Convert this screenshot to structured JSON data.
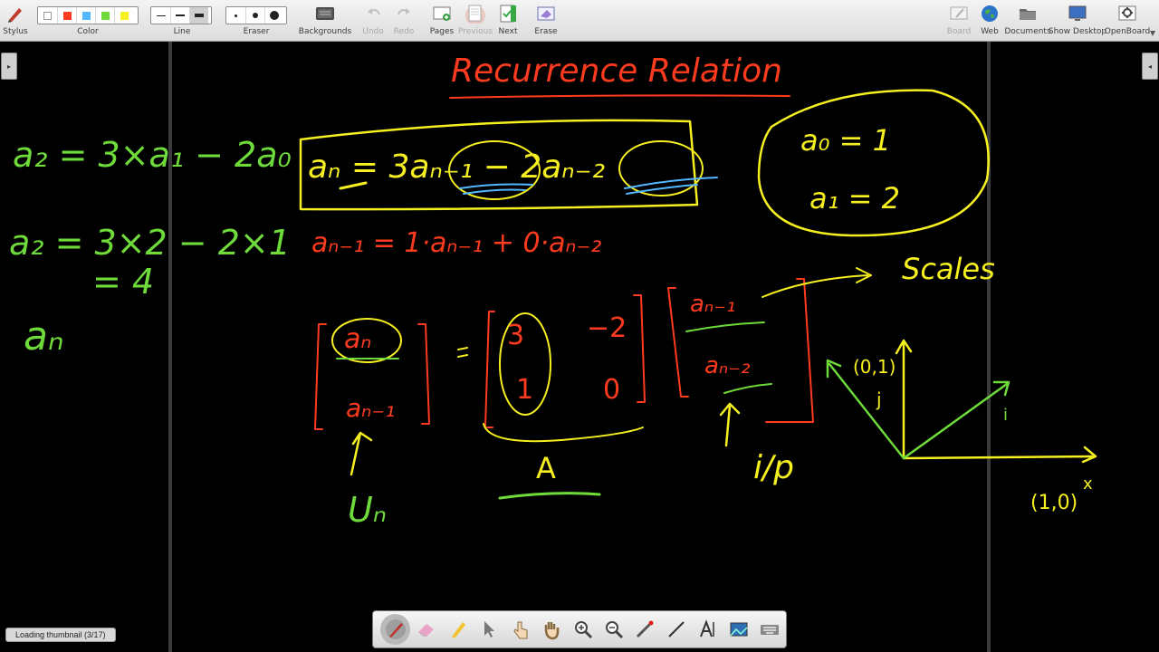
{
  "toolbar": {
    "stylus": "Stylus",
    "color": "Color",
    "line": "Line",
    "eraser": "Eraser",
    "backgrounds": "Backgrounds",
    "undo": "Undo",
    "redo": "Redo",
    "pages": "Pages",
    "previous": "Previous",
    "next": "Next",
    "erase": "Erase",
    "board": "Board",
    "web": "Web",
    "documents": "Documents",
    "show_desktop": "Show Desktop",
    "openboard": "OpenBoard"
  },
  "colors": {
    "palette": [
      "#ffffff",
      "#ff3b1f",
      "#53b8ff",
      "#6edb3a",
      "#f6f020"
    ],
    "ink_red": "#ff3b1f",
    "ink_yellow": "#f6f020",
    "ink_green": "#6edb3a",
    "ink_blue": "#53b8ff"
  },
  "board": {
    "title": "Recurrence Relation",
    "left_notes": [
      "a₂ = 3×a₁ − 2a₀",
      "a₂ = 3×2 − 2×1",
      "= 4",
      "aₙ"
    ],
    "recurrence": "aₙ = 3aₙ₋₁ − 2aₙ₋₂",
    "identity_line": "aₙ₋₁ = 1·aₙ₋₁ + 0·aₙ₋₂",
    "initial_conditions": [
      "a₀ = 1",
      "a₁ = 2"
    ],
    "vec_un_top": "aₙ",
    "vec_un_bottom": "aₙ₋₁",
    "un_label": "Uₙ",
    "matrix_entries": [
      "3",
      "−2",
      "1",
      "0"
    ],
    "matrix_label": "A",
    "vec_rhs_top": "aₙ₋₁",
    "vec_rhs_bottom": "aₙ₋₂",
    "ip_label": "i/p",
    "scales_label": "Scales",
    "axis_points": [
      "(0,1)",
      "(1,0)"
    ],
    "axis_labels": [
      "j",
      "x",
      "i"
    ]
  },
  "status": {
    "message": "Loading thumbnail (3/17)"
  }
}
